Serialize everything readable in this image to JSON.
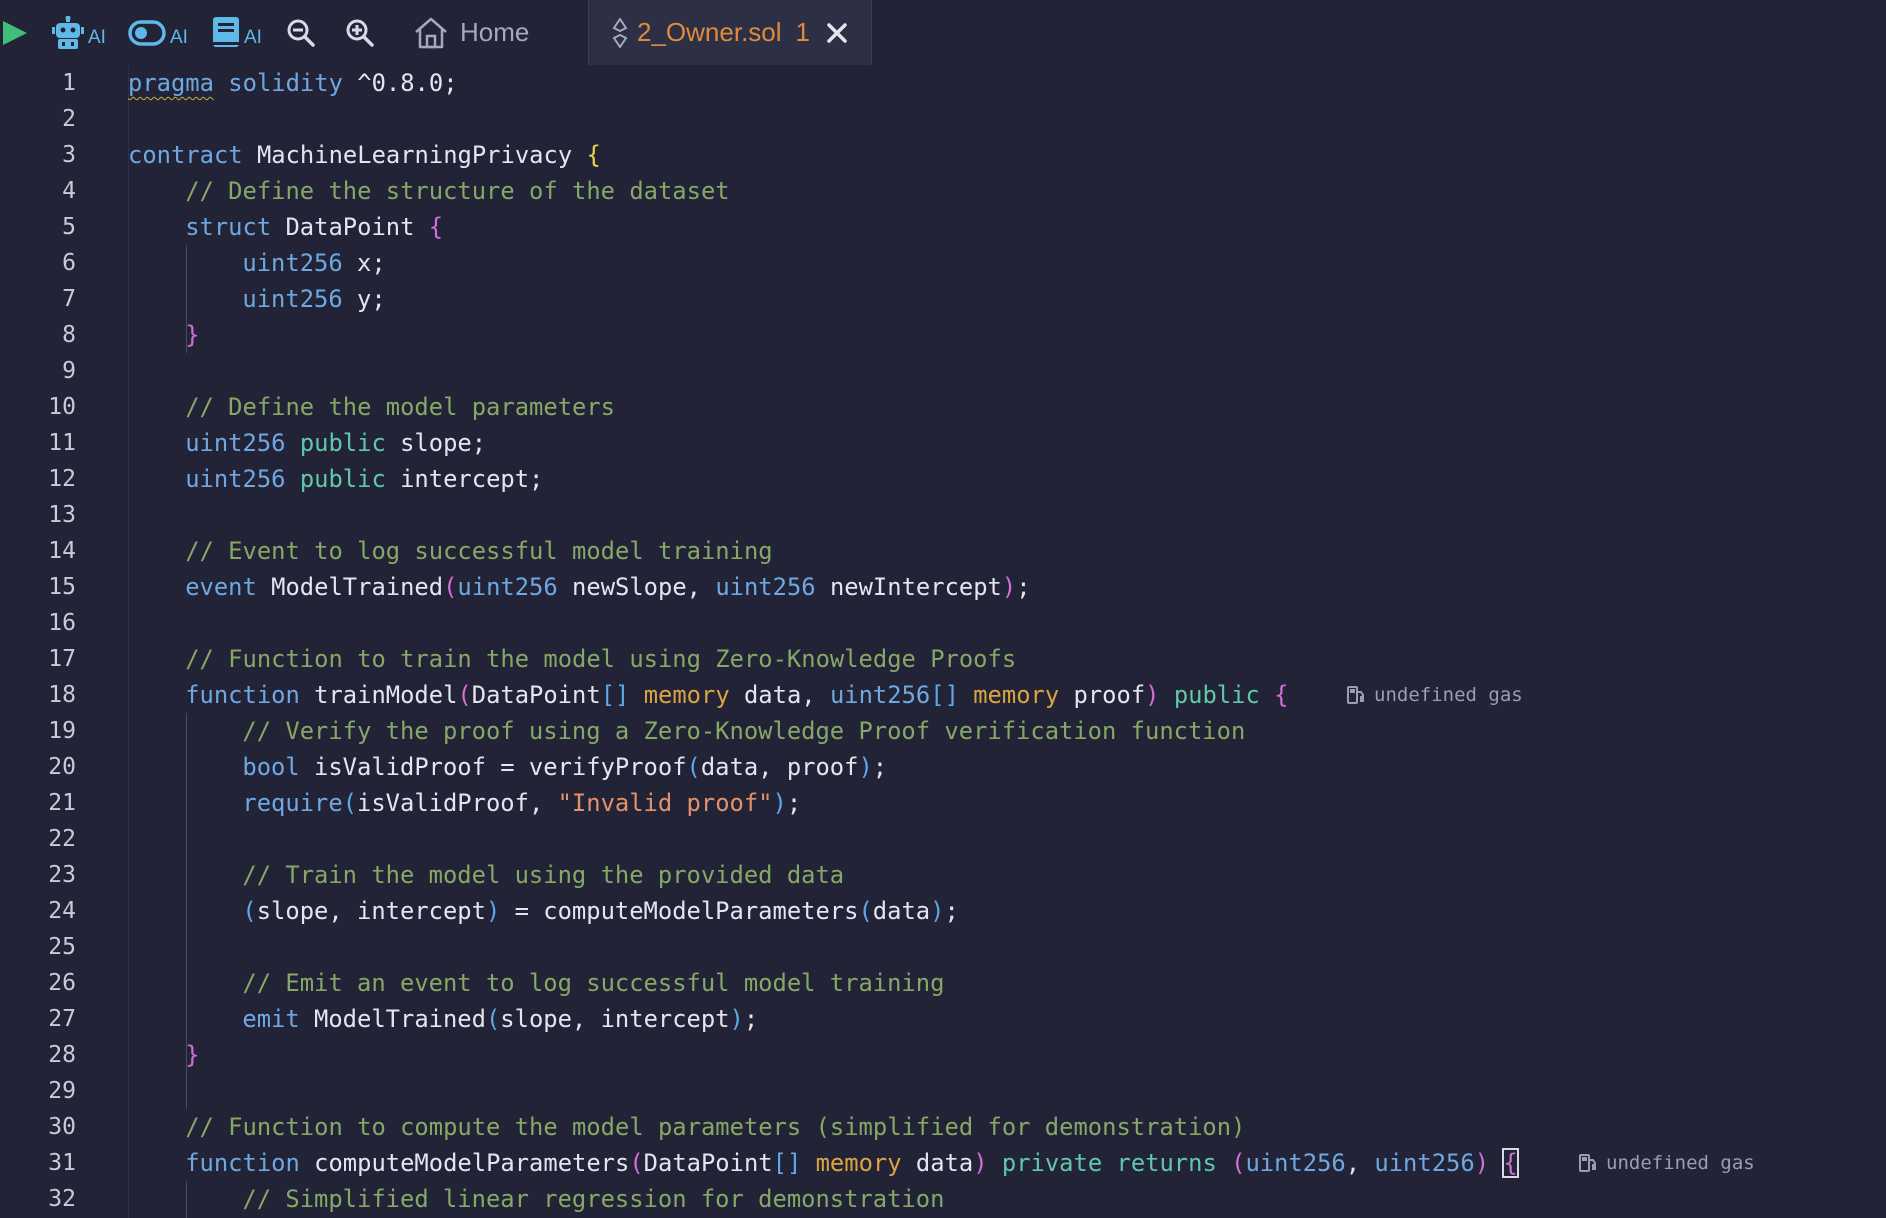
{
  "toolbar": {
    "ai_label": "AI",
    "home_label": "Home",
    "file_tab": {
      "name": "2_Owner.sol",
      "problem_count": "1"
    }
  },
  "gas_hint": "undefined gas",
  "lines": [
    "1",
    "2",
    "3",
    "4",
    "5",
    "6",
    "7",
    "8",
    "9",
    "10",
    "11",
    "12",
    "13",
    "14",
    "15",
    "16",
    "17",
    "18",
    "19",
    "20",
    "21",
    "22",
    "23",
    "24",
    "25",
    "26",
    "27",
    "28",
    "29",
    "30",
    "31",
    "32"
  ],
  "code": {
    "l1": [
      "pragma",
      " solidity ",
      "^0.8.0;"
    ],
    "l3": [
      "contract",
      " MachineLearningPrivacy ",
      "{"
    ],
    "l4": "// Define the structure of the dataset",
    "l5": [
      "struct",
      " DataPoint ",
      "{"
    ],
    "l6": [
      "uint256",
      " x;"
    ],
    "l7": [
      "uint256",
      " y;"
    ],
    "l8": "}",
    "l10": "// Define the model parameters",
    "l11": [
      "uint256",
      " ",
      "public",
      " slope;"
    ],
    "l12": [
      "uint256",
      " ",
      "public",
      " intercept;"
    ],
    "l14": "// Event to log successful model training",
    "l15": [
      "event",
      " ModelTrained",
      "(",
      "uint256",
      " newSlope, ",
      "uint256",
      " newIntercept",
      ")",
      ";"
    ],
    "l17": "// Function to train the model using Zero-Knowledge Proofs",
    "l18": [
      "function",
      " trainModel",
      "(",
      "DataPoint",
      "[]",
      " ",
      "memory",
      " data, ",
      "uint256",
      "[]",
      " ",
      "memory",
      " proof",
      ")",
      " ",
      "public",
      " ",
      "{"
    ],
    "l19": "// Verify the proof using a Zero-Knowledge Proof verification function",
    "l20": [
      "bool",
      " isValidProof = verifyProof",
      "(",
      "data, proof",
      ")",
      ";"
    ],
    "l21": [
      "require",
      "(",
      "isValidProof, ",
      "\"Invalid proof\"",
      ")",
      ";"
    ],
    "l23": "// Train the model using the provided data",
    "l24": [
      "(",
      "slope, intercept",
      ")",
      " = computeModelParameters",
      "(",
      "data",
      ")",
      ";"
    ],
    "l26": "// Emit an event to log successful model training",
    "l27": [
      "emit",
      " ModelTrained",
      "(",
      "slope, intercept",
      ")",
      ";"
    ],
    "l28": "}",
    "l30": "// Function to compute the model parameters (simplified for demonstration)",
    "l31": [
      "function",
      " computeModelParameters",
      "(",
      "DataPoint",
      "[]",
      " ",
      "memory",
      " data",
      ")",
      " ",
      "private",
      " ",
      "returns",
      " ",
      "(",
      "uint256",
      ", ",
      "uint256",
      ")",
      " ",
      "{"
    ],
    "l32": "// Simplified linear regression for demonstration"
  }
}
